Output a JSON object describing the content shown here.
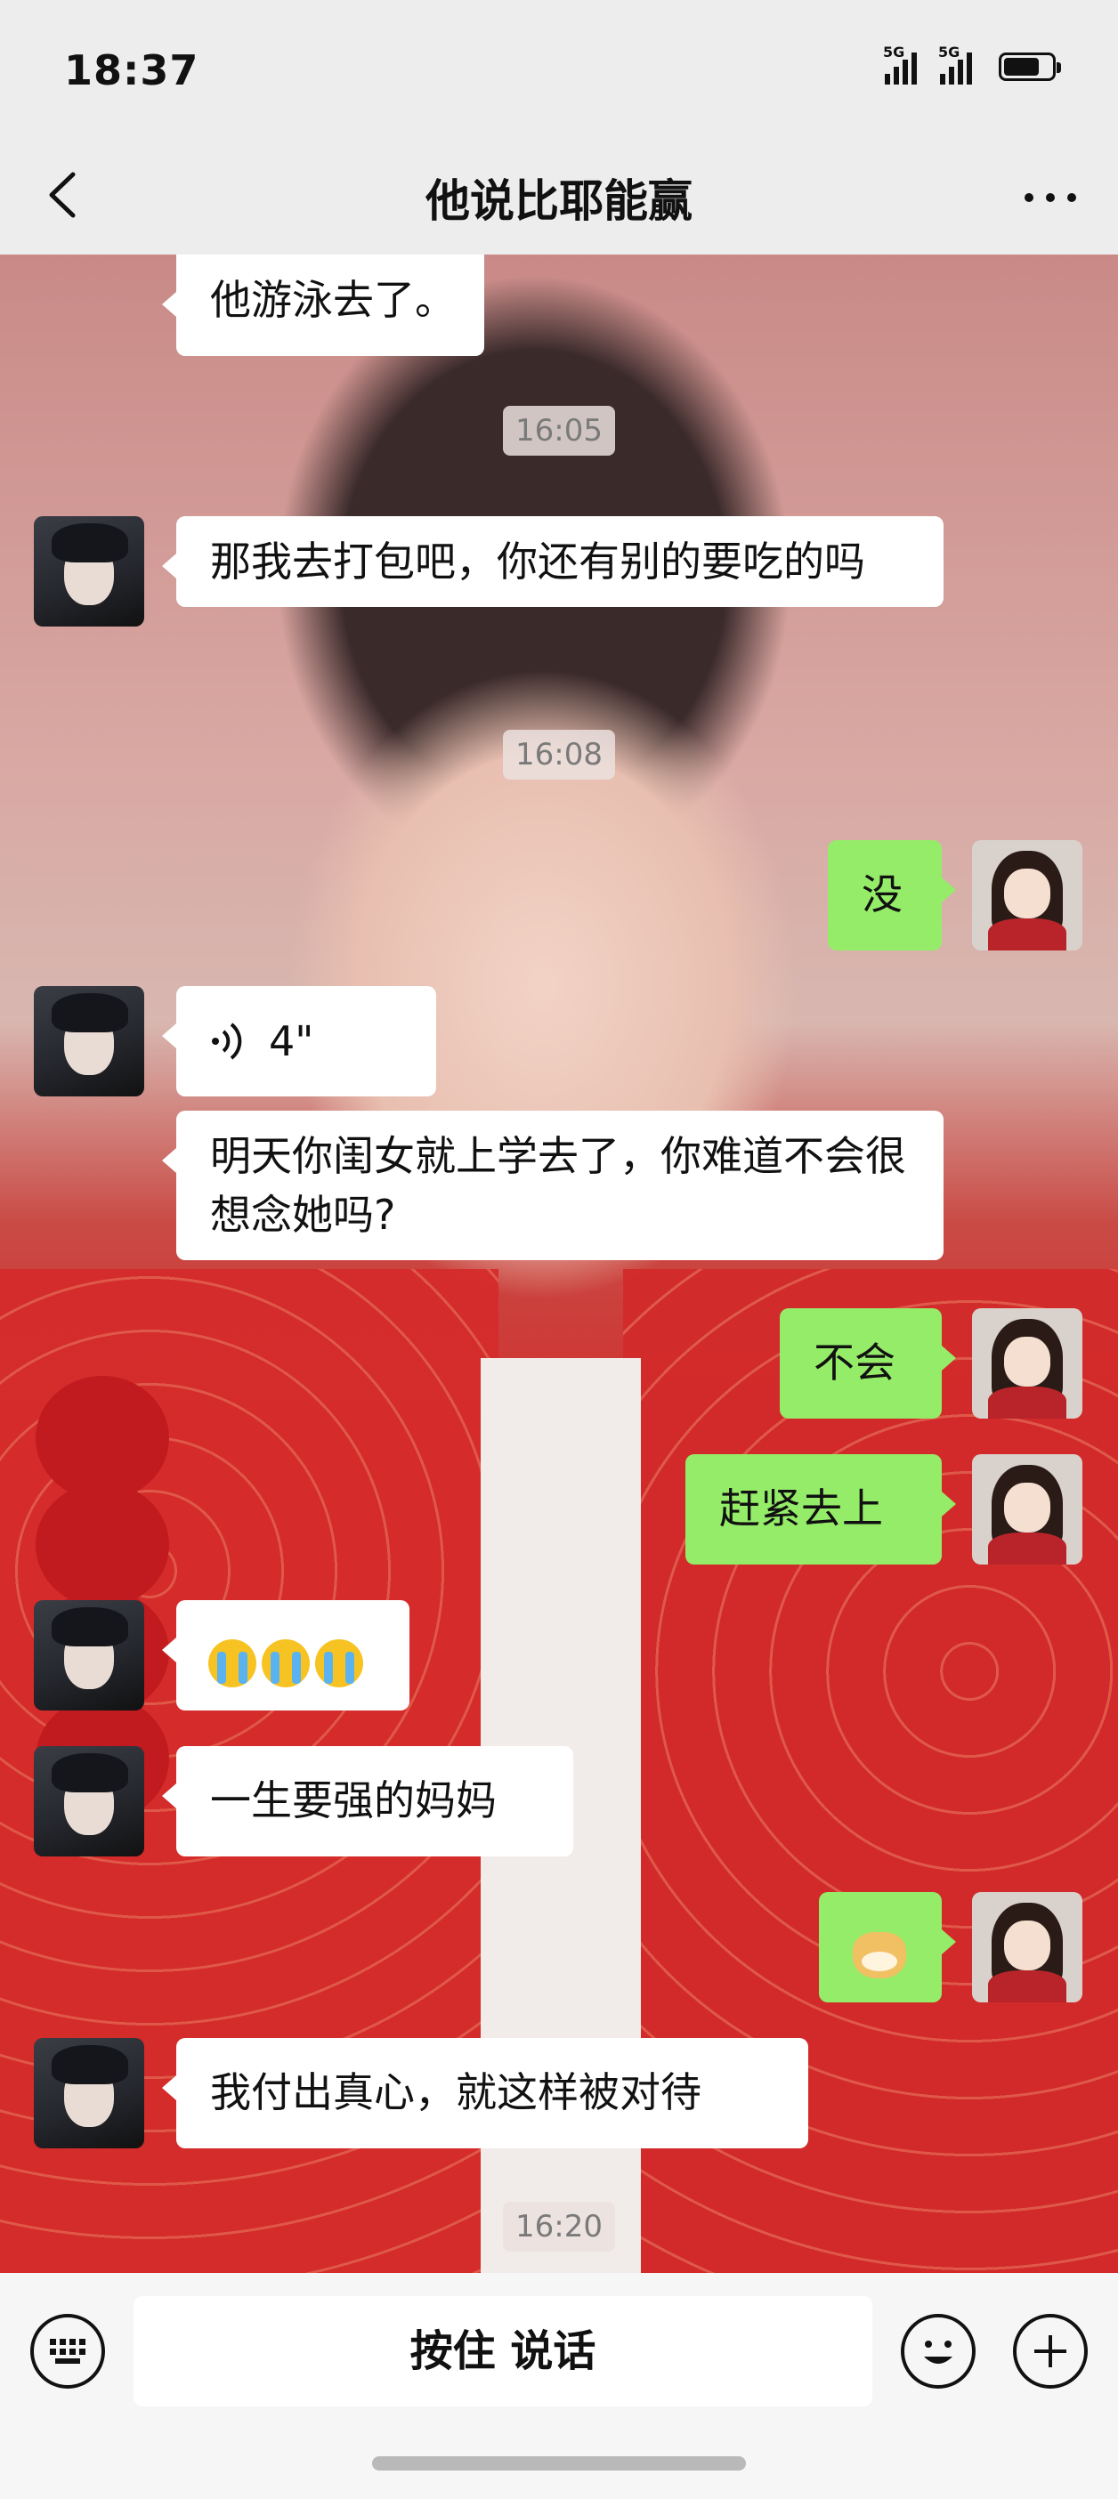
{
  "status_bar": {
    "time": "18:37",
    "signal_1_label": "5G",
    "signal_2_label": "5G",
    "battery_level": 0.75
  },
  "nav": {
    "title": "他说比耶能赢"
  },
  "messages": [
    {
      "side": "in",
      "text": "他游泳去了。"
    },
    {
      "timestamp": "16:05"
    },
    {
      "side": "in",
      "text": "那我去打包吧，你还有别的要吃的吗"
    },
    {
      "timestamp": "16:08"
    },
    {
      "side": "out",
      "text": "没"
    },
    {
      "side": "in",
      "type": "voice",
      "duration": "4\""
    },
    {
      "side": "in",
      "text": "明天你闺女就上学去了，你难道不会很想念她吗?"
    },
    {
      "side": "out",
      "text": "不会"
    },
    {
      "side": "out",
      "text": "赶紧去上"
    },
    {
      "side": "in",
      "type": "emoji",
      "emojis": [
        "crying-face",
        "crying-face",
        "crying-face"
      ]
    },
    {
      "side": "in",
      "text": "一生要强的妈妈"
    },
    {
      "side": "out",
      "type": "emoji",
      "emojis": [
        "doge"
      ]
    },
    {
      "side": "in",
      "text": "我付出真心，就这样被对待"
    },
    {
      "timestamp": "16:20"
    }
  ],
  "input": {
    "hold_to_talk": "按住 说话"
  },
  "colors": {
    "incoming_bubble": "#ffffff",
    "outgoing_bubble": "#95ec69",
    "bar_bg": "#ededed"
  }
}
